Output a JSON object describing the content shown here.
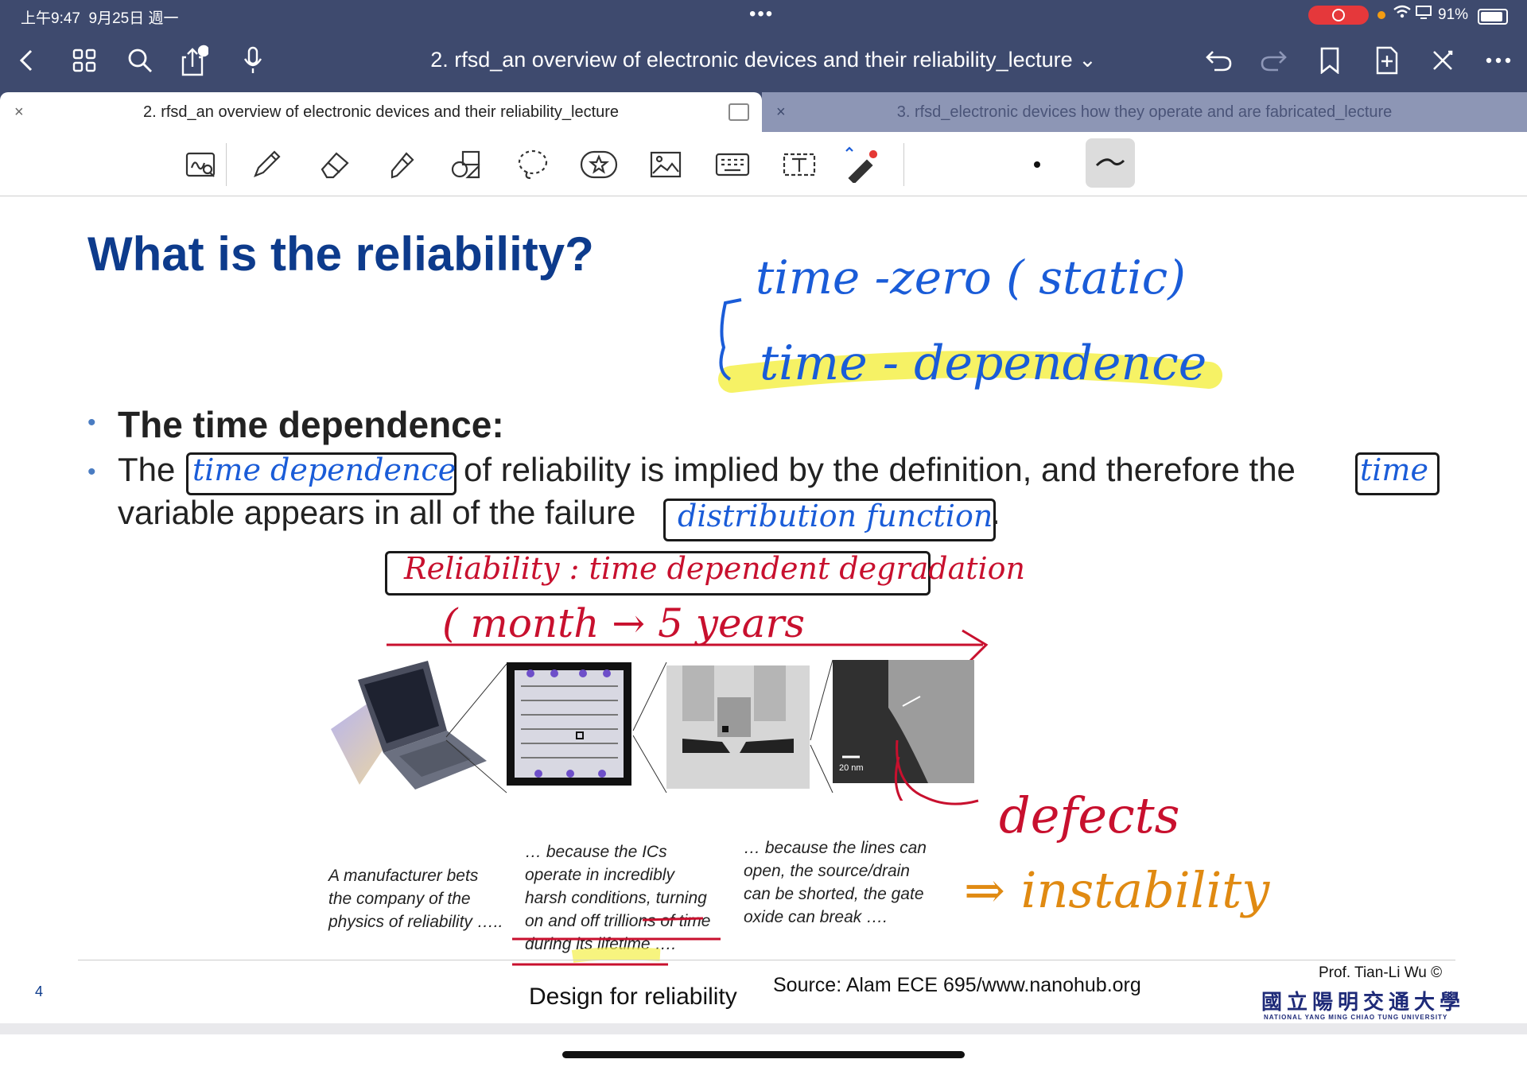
{
  "status_bar": {
    "time": "上午9:47",
    "date": "9月25日 週一",
    "dots": "•••",
    "battery": "91%"
  },
  "nav": {
    "document_title": "2. rfsd_an overview of electronic devices and their reliability_lecture ⌄"
  },
  "tabs": [
    {
      "label": "2. rfsd_an overview of electronic devices and their reliability_lecture",
      "close": "×",
      "active": true
    },
    {
      "label": "3. rfsd_electronic devices how they operate and are fabricated_lecture",
      "close": "×",
      "active": false
    }
  ],
  "slide": {
    "title": "What is the reliability?",
    "bullet1": "The time dependence:",
    "bullet2_line1_a": "The",
    "bullet2_line1_b": "of reliability is implied by the definition, and therefore the",
    "bullet2_line2": "variable appears in all of the failure",
    "bullet2_end": ".",
    "captions": {
      "c1": [
        "A manufacturer bets",
        "the company of the",
        "physics of reliability ….."
      ],
      "c2": [
        "… because the ICs",
        "operate in incredibly",
        "harsh conditions, turning",
        "on and off trillions of time",
        "during its lifetime …."
      ],
      "c3": [
        "… because the lines can",
        "open, the source/drain",
        "can be shorted, the gate",
        "oxide can break …."
      ]
    },
    "scale_label": "20 nm",
    "page_number": "4",
    "footer_title": "Design for reliability",
    "source": "Source: Alam ECE 695/www.nanohub.org",
    "author": "Prof. Tian-Li Wu ©",
    "university_cn": "國立陽明交通大學",
    "university_en": "NATIONAL YANG MING CHIAO TUNG UNIVERSITY"
  },
  "annotations": {
    "time_zero": "time -zero ( static)",
    "time_dependence_note": "time - dependence",
    "box_time_dependence": "time dependence",
    "box_time": "time",
    "box_distribution": "distribution function",
    "reliability_note": "Reliability : time dependent degradation",
    "month_years": "( month → 5 years",
    "defects": "defects",
    "instability": "⇒ instability"
  },
  "colors": {
    "appbar": "#3e4a6e",
    "title_blue": "#0d3b8c",
    "ink_blue": "#1a5cd8",
    "ink_red": "#c8102e",
    "ink_orange": "#e08a12",
    "highlight": "#f4f04a"
  },
  "icons": [
    "back-icon",
    "grid-icon",
    "search-icon",
    "share-icon",
    "mic-icon",
    "undo-icon",
    "redo-icon",
    "bookmark-icon",
    "add-page-icon",
    "close-cross-icon",
    "more-icon",
    "zoom-draw-icon",
    "pencil-icon",
    "eraser-icon",
    "highlighter-icon",
    "shapes-icon",
    "lasso-icon",
    "sticker-icon",
    "image-icon",
    "keyboard-icon",
    "text-icon",
    "laser-icon"
  ]
}
